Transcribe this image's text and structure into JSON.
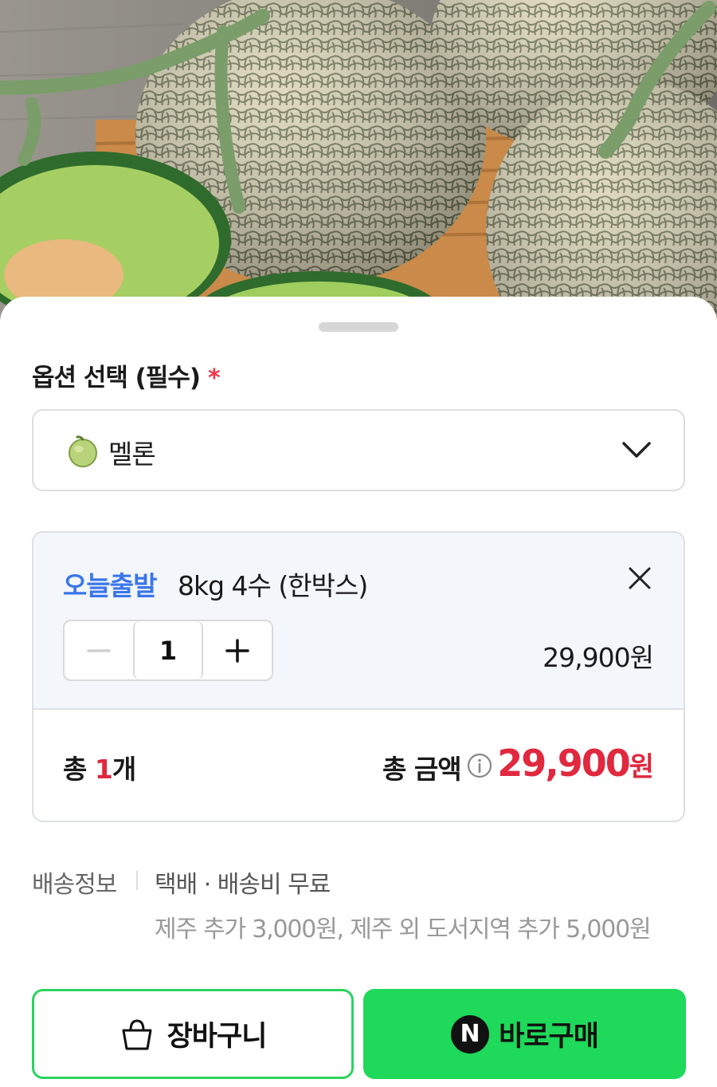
{
  "hero": {
    "alt": "melons"
  },
  "options": {
    "title": "옵션 선택 (필수)",
    "required_mark": "*",
    "selected": "멜론",
    "selected_icon": "melon-emoji-icon"
  },
  "item": {
    "tag": "오늘출발",
    "name": "8kg 4수 (한박스)",
    "quantity": "1",
    "price": "29,900원"
  },
  "summary": {
    "count_prefix": "총 ",
    "count_num": "1",
    "count_suffix": "개",
    "total_label": "총 금액",
    "total_amount": "29,900",
    "total_unit": "원"
  },
  "shipping": {
    "label": "배송정보",
    "method": "택배 · 배송비 무료",
    "extra": "제주 추가 3,000원, 제주 외 도서지역 추가 5,000원"
  },
  "actions": {
    "cart_label": "장바구니",
    "buy_label": "바로구매",
    "buy_icon_letter": "N"
  },
  "colors": {
    "accent_red": "#e0283e",
    "tag_blue": "#3a76e8",
    "naver_green": "#1fd95a"
  }
}
